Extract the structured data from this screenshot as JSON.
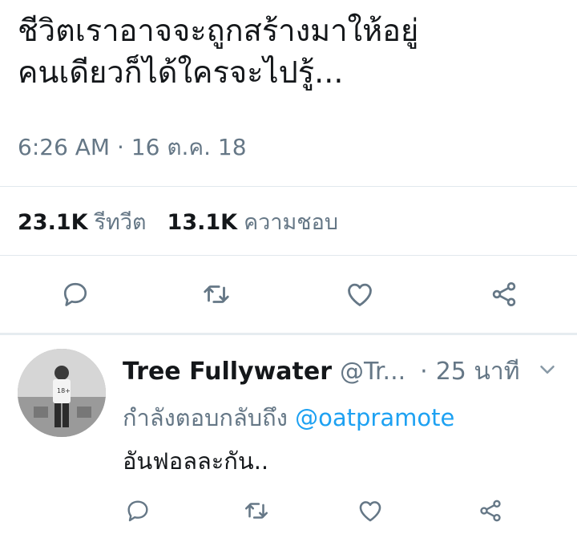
{
  "tweet": {
    "text_line1": "ชีวิตเราอาจจะถูกสร้างมาให้อยู่",
    "text_line2": "คนเดียวก็ได้ใครจะไปรู้...",
    "timestamp": "6:26 AM · 16 ต.ค. 18",
    "retweets_count": "23.1K",
    "retweets_label": "รีทวีต",
    "likes_count": "13.1K",
    "likes_label": "ความชอบ",
    "actions": [
      "reply-icon",
      "retweet-icon",
      "like-icon",
      "share-icon"
    ]
  },
  "reply": {
    "name": "Tree Fullywater",
    "handle": "@Tr...",
    "separator": "·",
    "time": "25 นาที",
    "replying_prefix": "กำลังตอบกลับถึง",
    "replying_mention": "@oatpramote",
    "text": "อันฟอลละกัน..",
    "avatar_text": "18+",
    "actions": [
      "reply-icon",
      "retweet-icon",
      "like-icon",
      "share-icon"
    ]
  },
  "colors": {
    "text": "#14171a",
    "muted": "#657786",
    "link": "#1da1f2",
    "divider": "#e1e8ed"
  }
}
